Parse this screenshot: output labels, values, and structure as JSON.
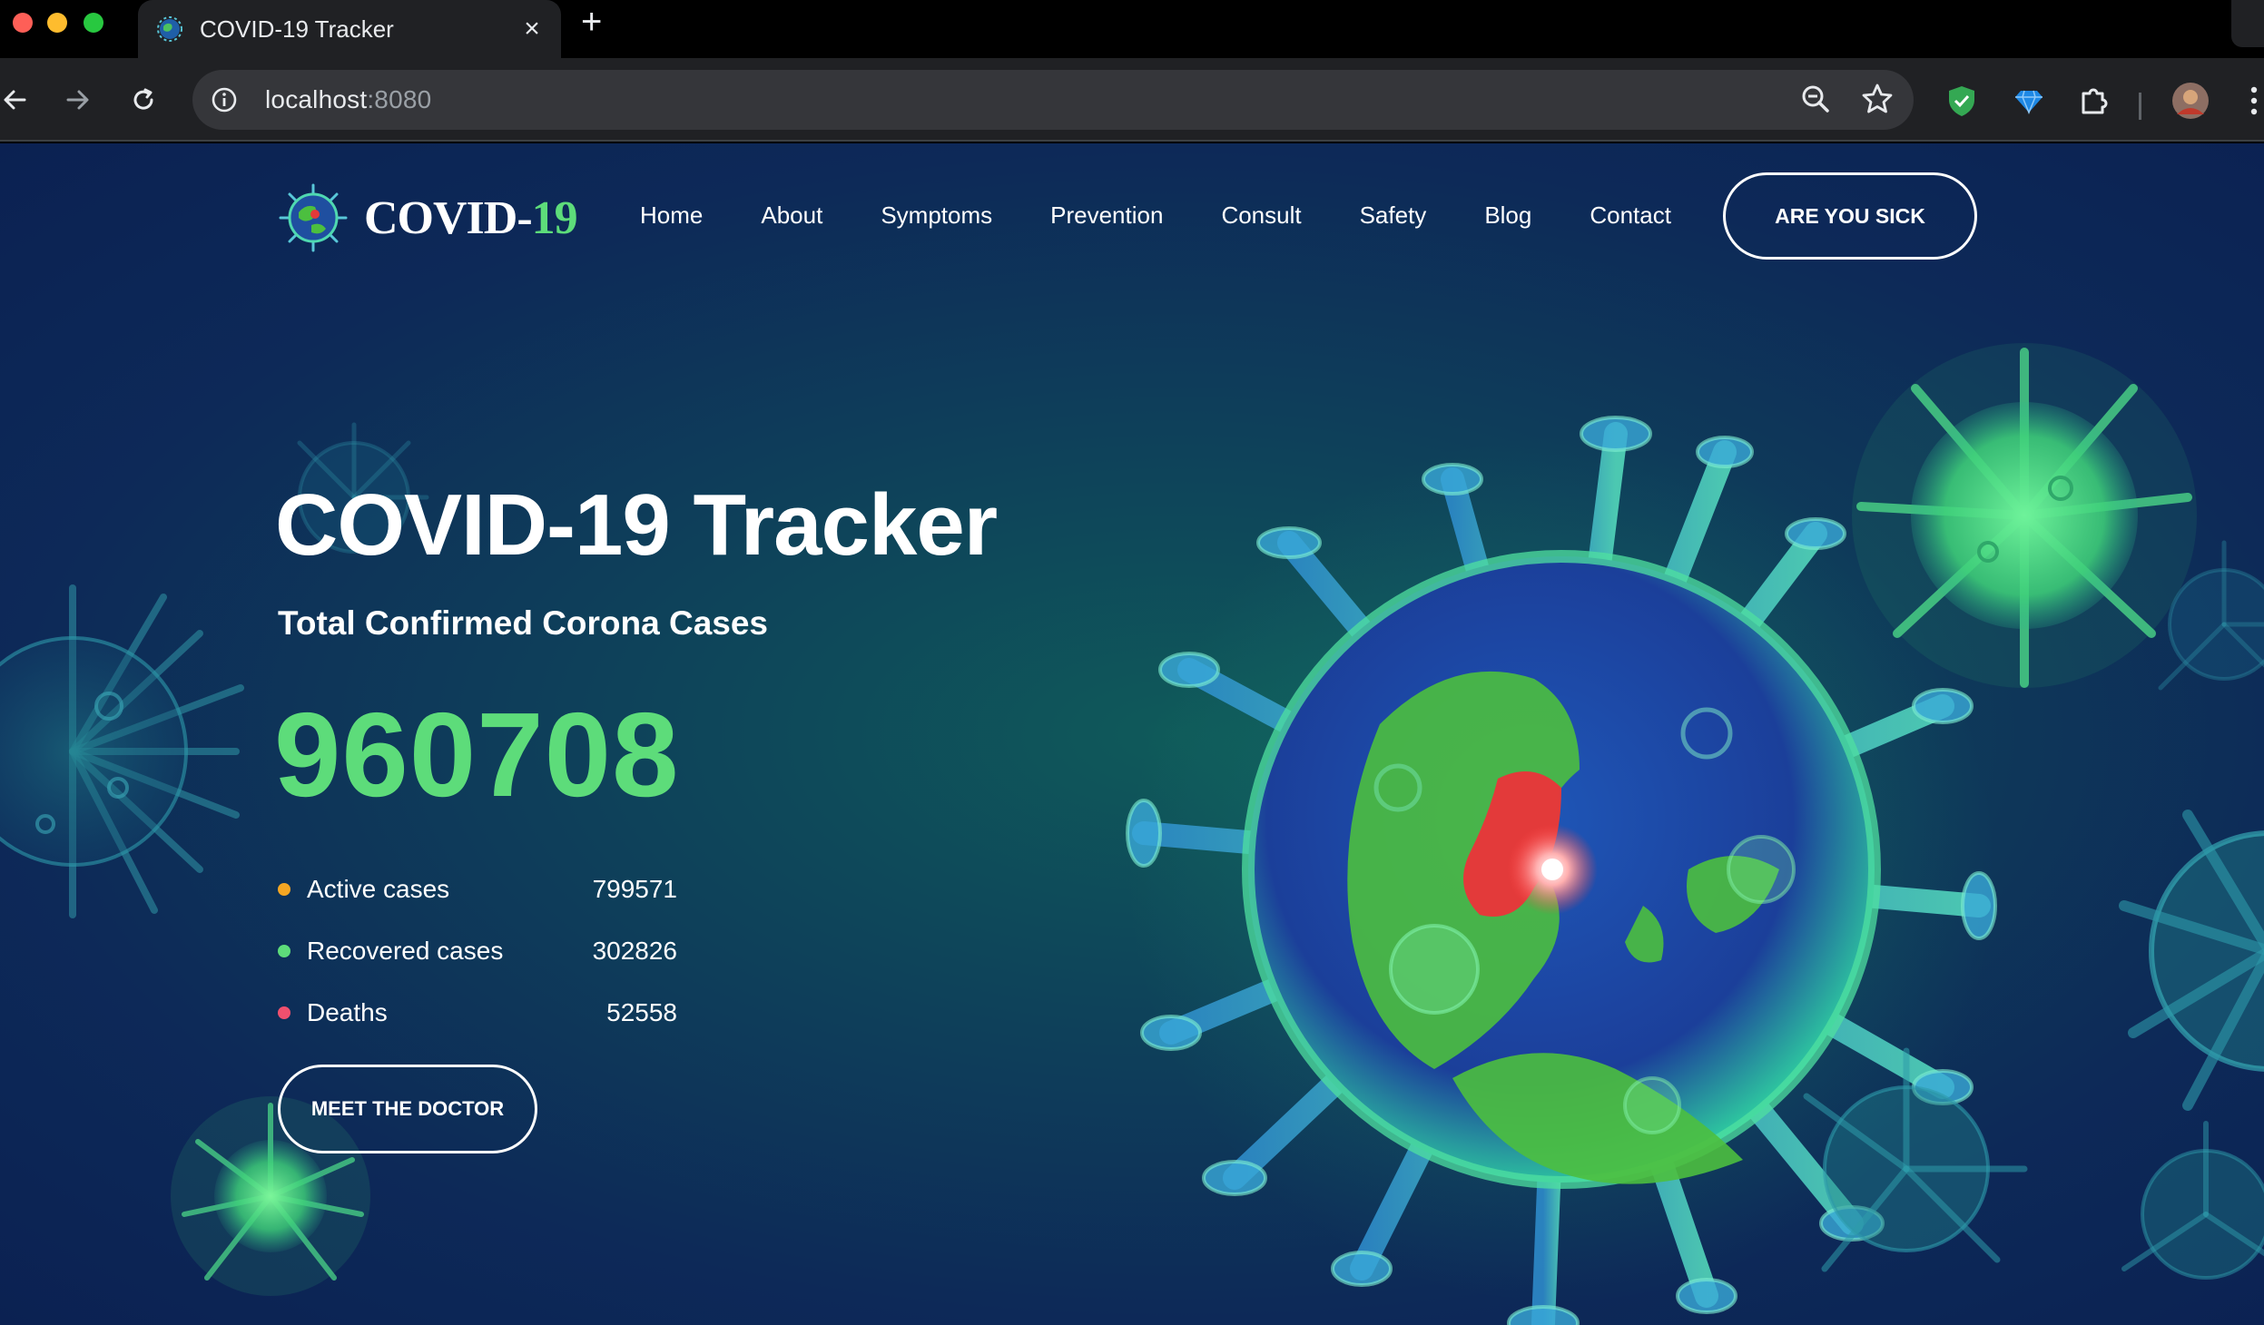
{
  "browser": {
    "tab_title": "COVID-19 Tracker",
    "url_host": "localhost",
    "url_port": ":8080",
    "colors": {
      "tab_bg": "#202124",
      "omnibox_bg": "#35363a"
    }
  },
  "header": {
    "brand_main": "COVID-",
    "brand_accent": "19",
    "nav": [
      "Home",
      "About",
      "Symptoms",
      "Prevention",
      "Consult",
      "Safety",
      "Blog",
      "Contact"
    ],
    "cta_label": "ARE YOU SICK"
  },
  "hero": {
    "title": "COVID-19 Tracker",
    "subtitle": "Total Confirmed Corona Cases",
    "total": "960708",
    "stats": [
      {
        "label": "Active cases",
        "value": "799571",
        "color": "#f5a623"
      },
      {
        "label": "Recovered cases",
        "value": "302826",
        "color": "#5ddc7a"
      },
      {
        "label": "Deaths",
        "value": "52558",
        "color": "#f0506e"
      }
    ],
    "cta_label": "MEET THE DOCTOR"
  },
  "colors": {
    "accent_green": "#5ddc7a",
    "page_bg": "#0d2958"
  },
  "icons": [
    "back-arrow-icon",
    "forward-arrow-icon",
    "reload-icon",
    "info-icon",
    "zoom-icon",
    "star-icon",
    "shield-extension-icon",
    "diamond-extension-icon",
    "puzzle-icon",
    "profile-avatar",
    "kebab-menu-icon",
    "virus-globe-icon"
  ]
}
